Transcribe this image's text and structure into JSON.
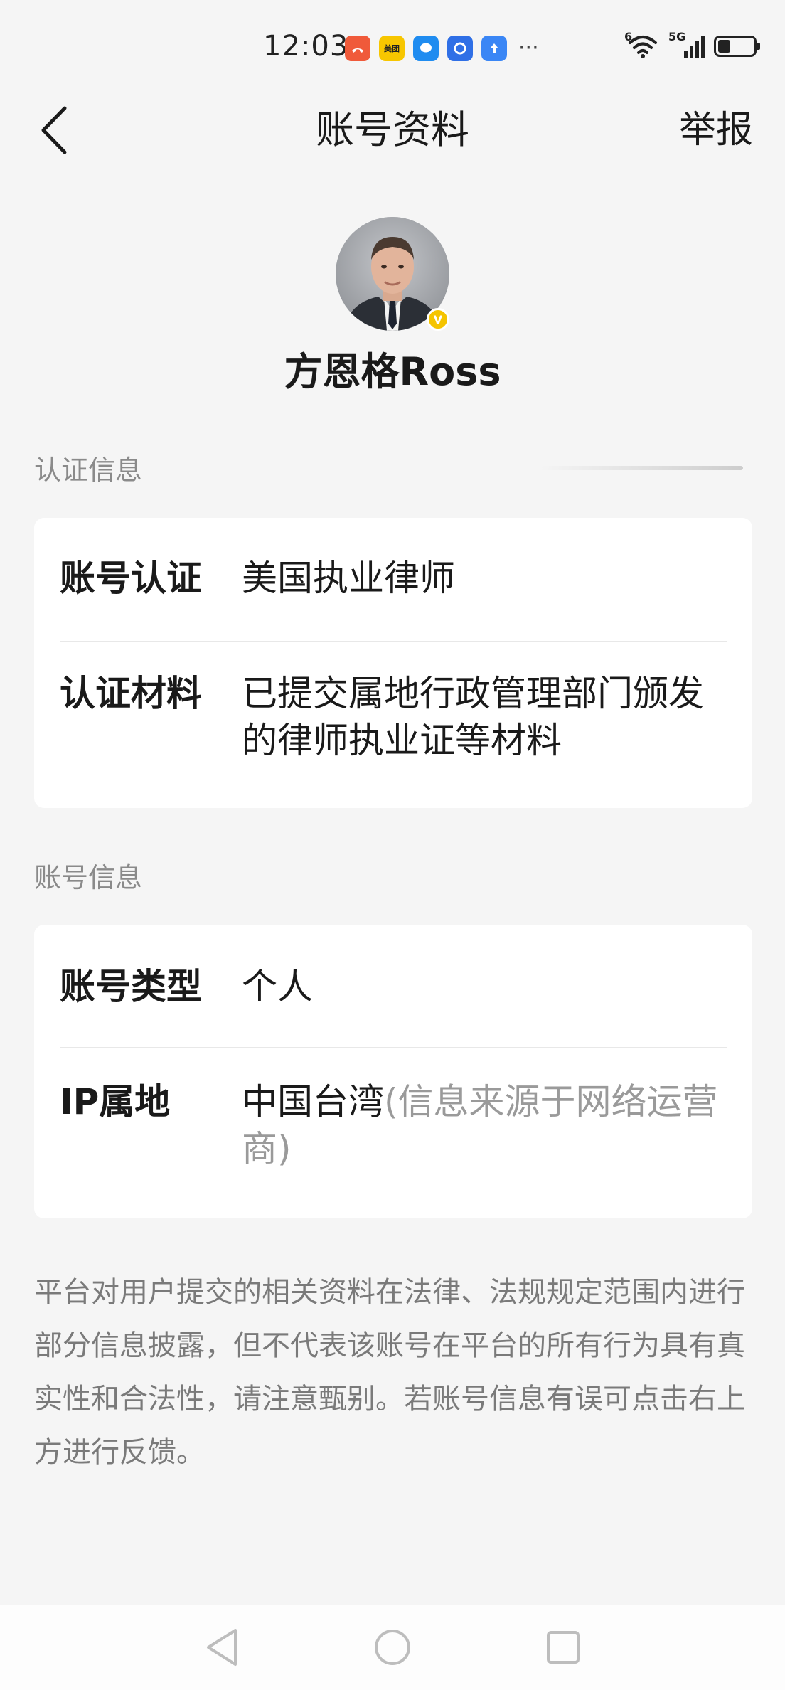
{
  "status_bar": {
    "time": "12:03",
    "notification_icons": [
      {
        "icon": "missed-call-icon",
        "color": "#f05a3a"
      },
      {
        "icon": "meituan-icon",
        "color": "#f7c600",
        "text": "美团"
      },
      {
        "icon": "message-icon",
        "color": "#1f8cf0"
      },
      {
        "icon": "app-icon",
        "color": "#2f6fe6"
      },
      {
        "icon": "upload-icon",
        "color": "#3a86f5"
      }
    ],
    "more": "···",
    "wifi_label": "6",
    "network_label": "5G",
    "battery_level": 0.35
  },
  "nav": {
    "title": "账号资料",
    "report_label": "举报"
  },
  "profile": {
    "name": "方恩格Ross",
    "verified_badge": "V"
  },
  "certification_section": {
    "label": "认证信息",
    "rows": [
      {
        "label": "账号认证",
        "value": "美国执业律师"
      },
      {
        "label": "认证材料",
        "value": "已提交属地行政管理部门颁发的律师执业证等材料"
      }
    ]
  },
  "account_section": {
    "label": "账号信息",
    "rows": [
      {
        "label": "账号类型",
        "value": "个人"
      },
      {
        "label": "IP属地",
        "value": "中国台湾",
        "note": "(信息来源于网络运营商)"
      }
    ]
  },
  "disclaimer": "平台对用户提交的相关资料在法律、法规规定范围内进行部分信息披露，但不代表该账号在平台的所有行为具有真实性和合法性，请注意甄别。若账号信息有误可点击右上方进行反馈。",
  "colors": {
    "background": "#f5f5f5",
    "card": "#ffffff",
    "label_gray": "#8a8a8a",
    "badge_yellow": "#f5c400"
  }
}
